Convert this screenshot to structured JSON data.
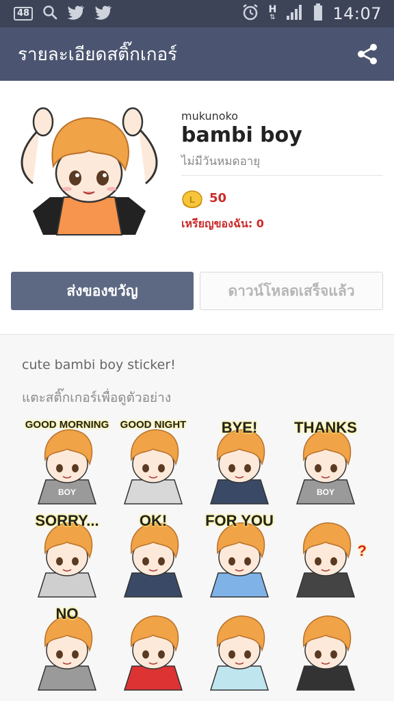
{
  "status": {
    "badge": "48",
    "time": "14:07",
    "h_indicator": "H"
  },
  "appbar": {
    "title": "รายละเอียดสติ๊กเกอร์"
  },
  "product": {
    "author": "mukunoko",
    "name": "bambi boy",
    "validity": "ไม่มีวันหมดอายุ",
    "price": "50",
    "my_coins": "เหรียญของฉัน: 0"
  },
  "buttons": {
    "gift": "ส่งของขวัญ",
    "downloaded": "ดาวน์โหลดเสร็จแล้ว"
  },
  "details": {
    "description": "cute bambi boy sticker!",
    "hint": "แตะสติ๊กเกอร์เพื่อดูตัวอย่าง"
  },
  "stickers": [
    {
      "caption": "GOOD MORNING",
      "shirt": "BOY"
    },
    {
      "caption": "GOOD NIGHT",
      "shirt": ""
    },
    {
      "caption": "BYE!",
      "shirt": ""
    },
    {
      "caption": "THANKS",
      "shirt": "BOY"
    },
    {
      "caption": "SORRY...",
      "shirt": ""
    },
    {
      "caption": "OK!",
      "shirt": ""
    },
    {
      "caption": "FOR YOU",
      "shirt": ""
    },
    {
      "caption": "?",
      "shirt": ""
    },
    {
      "caption": "NO",
      "shirt": ""
    },
    {
      "caption": "",
      "shirt": ""
    },
    {
      "caption": "",
      "shirt": ""
    },
    {
      "caption": "",
      "shirt": ""
    }
  ],
  "colors": {
    "statusbar": "#3d4458",
    "appbar": "#4b5470",
    "gift_button": "#5d6883",
    "price_red": "#cc2a2a",
    "hair": "#f0a347"
  }
}
